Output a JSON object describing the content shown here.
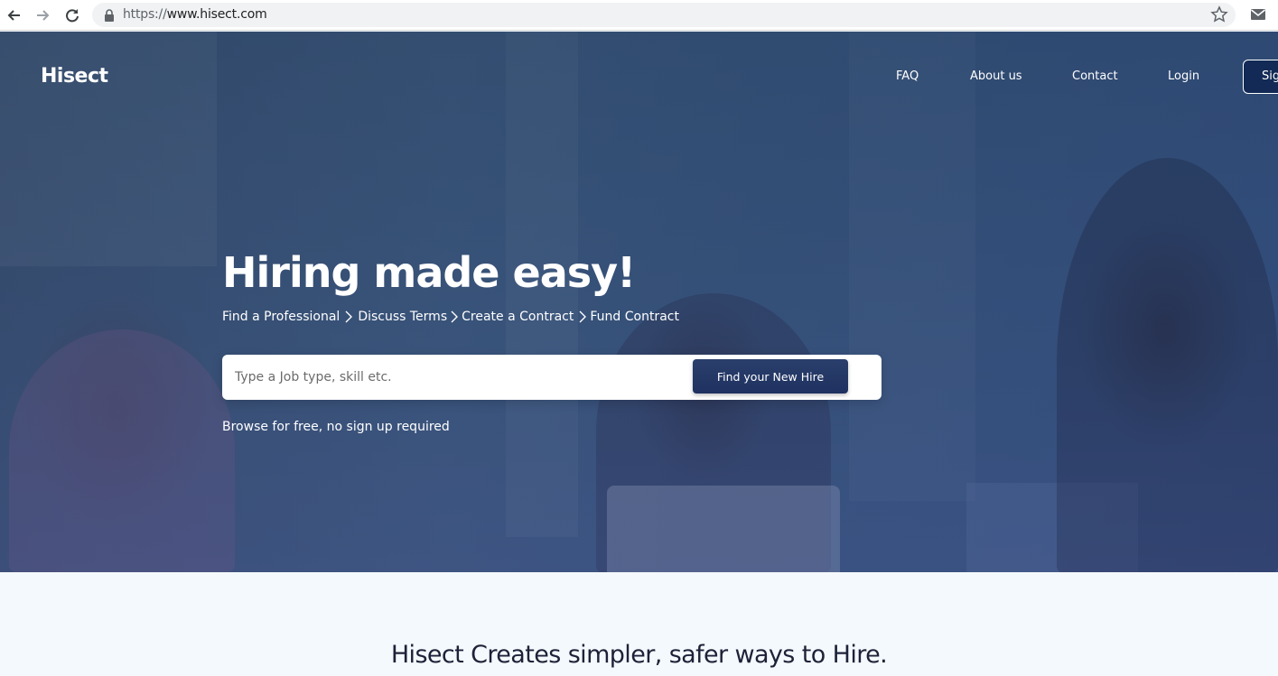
{
  "browser": {
    "url_scheme": "https://",
    "url_host": "www.hisect.com",
    "back_icon": "arrow-left-icon",
    "forward_icon": "arrow-right-icon",
    "reload_icon": "reload-icon",
    "bookmark_icon": "star-icon",
    "mail_icon": "mail-icon"
  },
  "header": {
    "brand": "Hisect",
    "nav": [
      "FAQ",
      "About us",
      "Contact",
      "Login"
    ],
    "signup_label": "Sig"
  },
  "hero": {
    "headline": "Hiring made easy!",
    "steps": [
      "Find a Professional",
      "Discuss Terms",
      "Create a Contract",
      "Fund Contract"
    ],
    "search_placeholder": "Type a Job type, skill etc.",
    "search_button": "Find your New Hire",
    "browse_note": "Browse for free, no sign up required"
  },
  "section": {
    "title": "Hisect Creates simpler, safer ways to Hire."
  },
  "colors": {
    "hero_overlay": "#3a5477",
    "button_dark": "#1e3160",
    "page_bg": "#f4f9fd",
    "title_text": "#1d2238"
  }
}
